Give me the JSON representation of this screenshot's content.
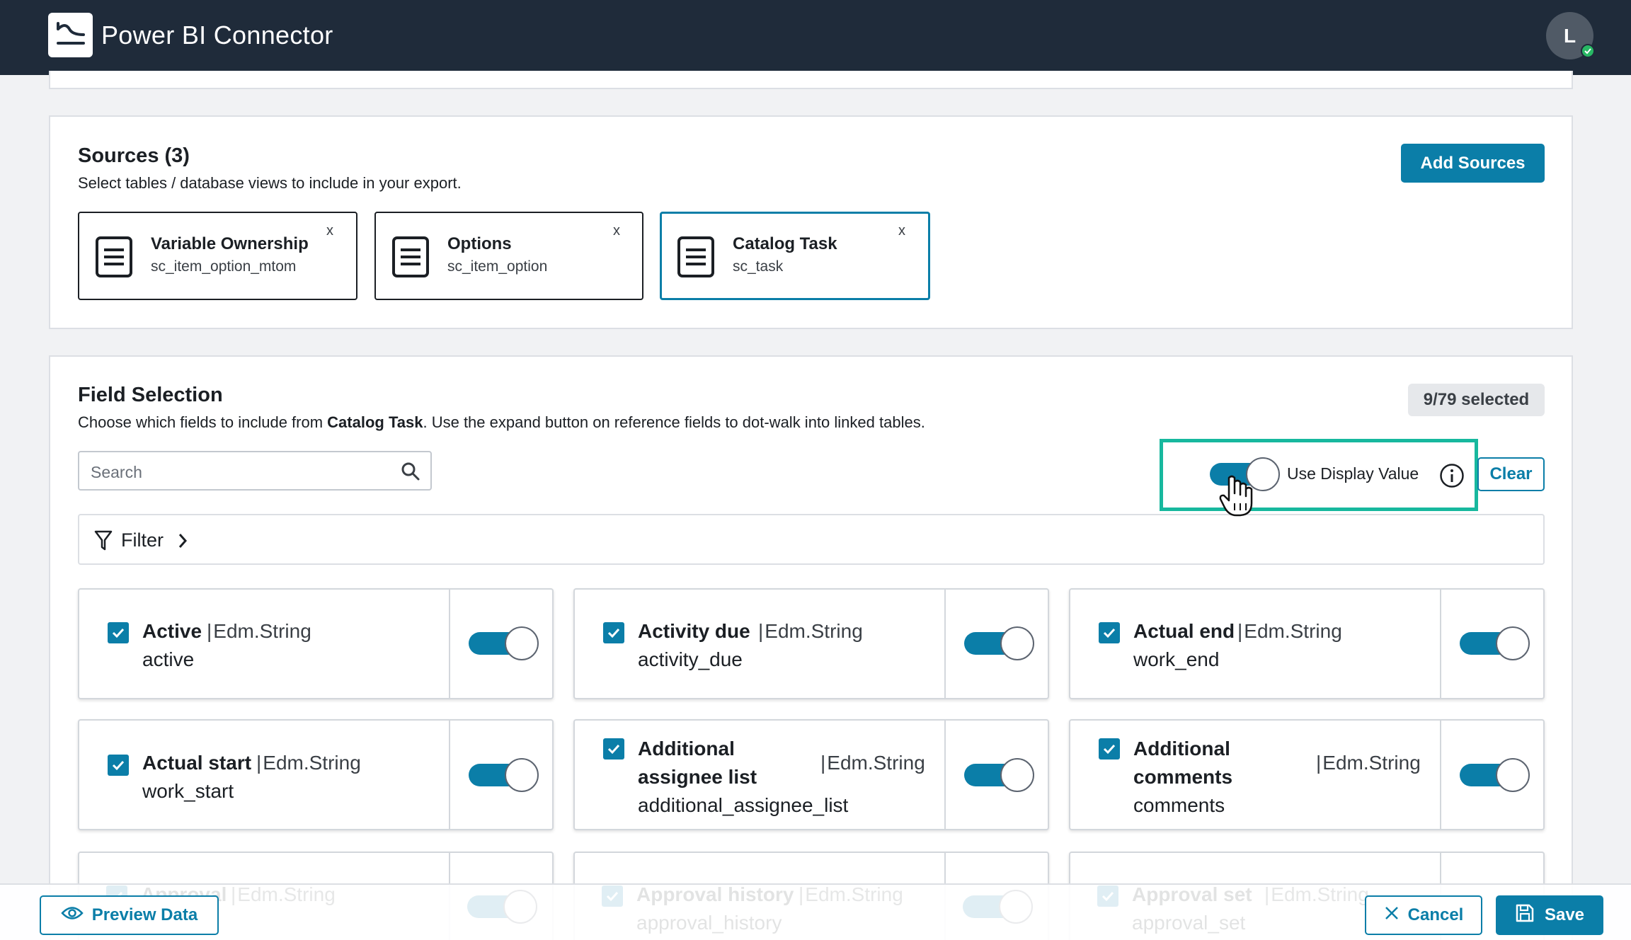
{
  "app": {
    "title": "Power BI Connector",
    "logo_icon": "chart-line-icon"
  },
  "user": {
    "avatar_initial": "L",
    "status": "online"
  },
  "sources": {
    "title": "Sources (3)",
    "description": "Select tables / database views to include in your export.",
    "add_button": "Add Sources",
    "items": [
      {
        "name": "Variable Ownership",
        "table": "sc_item_option_mtom",
        "close": "x",
        "active": false
      },
      {
        "name": "Options",
        "table": "sc_item_option",
        "close": "x",
        "active": false
      },
      {
        "name": "Catalog Task",
        "table": "sc_task",
        "close": "x",
        "active": true
      }
    ]
  },
  "fields": {
    "title": "Field Selection",
    "desc_prefix": "Choose which fields to include from ",
    "desc_table": "Catalog Task",
    "desc_suffix": ". Use the expand button on reference fields to dot-walk into linked tables.",
    "selected_badge": "9/79 selected",
    "search_placeholder": "Search",
    "display_value_label": "Use Display Value",
    "display_value_on": true,
    "clear_button": "Clear",
    "filter_label": "Filter",
    "separator": "|",
    "items": [
      {
        "name": "Active",
        "type": "Edm.String",
        "api": "active",
        "checked": true,
        "display": true
      },
      {
        "name": "Activity due",
        "type": "Edm.String",
        "api": "activity_due",
        "checked": true,
        "display": true
      },
      {
        "name": "Actual end",
        "type": "Edm.String",
        "api": "work_end",
        "checked": true,
        "display": true
      },
      {
        "name": "Actual start",
        "type": "Edm.String",
        "api": "work_start",
        "checked": true,
        "display": true
      },
      {
        "name_line1": "Additional",
        "name_line2": "assignee list",
        "type": "Edm.String",
        "api": "additional_assignee_list",
        "checked": true,
        "display": true
      },
      {
        "name_line1": "Additional",
        "name_line2": "comments",
        "type": "Edm.String",
        "api": "comments",
        "checked": true,
        "display": true
      },
      {
        "name": "Approval",
        "type": "Edm.String",
        "api": "",
        "checked": true,
        "display": true
      },
      {
        "name": "Approval history",
        "type": "Edm.String",
        "api": "approval_history",
        "checked": true,
        "display": true
      },
      {
        "name": "Approval set",
        "type": "Edm.String",
        "api": "approval_set",
        "checked": true,
        "display": true
      }
    ]
  },
  "footer": {
    "preview_button": "Preview Data",
    "cancel_button": "Cancel",
    "save_button": "Save"
  },
  "colors": {
    "accent": "#0b7ea8",
    "topbar": "#1f2b3a",
    "highlight": "#17b89e"
  }
}
